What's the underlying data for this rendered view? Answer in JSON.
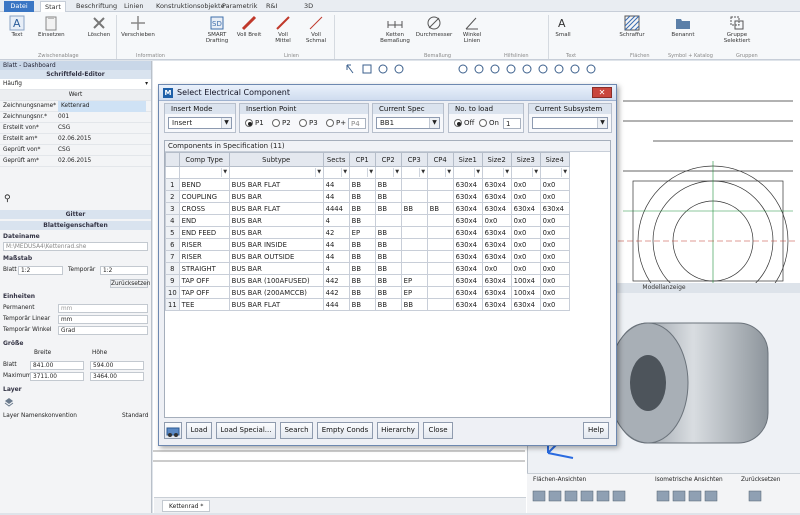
{
  "ribbon": {
    "tabs": [
      "Datei",
      "Start",
      "Beschriftung",
      "Linien",
      "Konstruktionsobjekte",
      "Parametrik",
      "R&I",
      "3D"
    ],
    "tools": [
      "Text",
      "Einsetzen",
      "Löschen",
      "Verschieben",
      "SMART Drafting",
      "Voll Breit",
      "Voll Mittel",
      "Voll Schmal",
      "Ketten Bemaßung",
      "Durchmesser",
      "Winkel Linien",
      "Small",
      "Schraffur",
      "Benannt",
      "Gruppe Selektiert"
    ],
    "groups": [
      "Zwischenablage",
      "Information",
      "Linien",
      "Bemaßung",
      "Hilfslinien",
      "Text",
      "Flächen",
      "Symbol + Katalog",
      "Gruppen"
    ]
  },
  "left_panel": {
    "header": "Blatt - Dashboard",
    "title_editor": "Schriftfeld-Editor",
    "preset": "Häufig",
    "value_header": "Wert",
    "rows": [
      {
        "k": "Zeichnungsname*",
        "v": "Kettenrad"
      },
      {
        "k": "Zeichnungsnr.*",
        "v": "001"
      },
      {
        "k": "Erstellt von*",
        "v": "CSG"
      },
      {
        "k": "Erstellt am*",
        "v": "02.06.2015"
      },
      {
        "k": "Geprüft von*",
        "v": "CSG"
      },
      {
        "k": "Geprüft am*",
        "v": "02.06.2015"
      }
    ],
    "grid_label": "Gitter",
    "sheet_props": "Blatteigenschaften",
    "file_label": "Dateiname",
    "file_value": "M:\\MEDUSA4\\Kettenrad.she",
    "scale_label": "Maßstab",
    "sheet_label": "Blatt",
    "sheet_scale": "1:2",
    "temp_label": "Temporär",
    "temp_scale": "1:2",
    "reset_btn": "Zurücksetzen",
    "units_label": "Einheiten",
    "perm_label": "Permanent",
    "perm_value": "mm",
    "temp_linear_label": "Temporär Linear",
    "temp_linear_value": "mm",
    "temp_angle_label": "Temporär Winkel",
    "temp_angle_value": "Grad",
    "size_label": "Größe",
    "width_label": "Breite",
    "height_label": "Höhe",
    "blatt_label": "Blatt",
    "blatt_w": "841.00",
    "blatt_h": "594.00",
    "max_label": "Maximum",
    "max_w": "3711.00",
    "max_h": "3464.00",
    "layer_label": "Layer",
    "layer_conv_label": "Layer Namenskonvention",
    "layer_conv_value": "Standard"
  },
  "model": {
    "title": "Modellanzeige",
    "bar": [
      "Flächen-Ansichten",
      "Isometrische Ansichten",
      "Zurücksetzen"
    ]
  },
  "doc_tab": "Kettenrad *",
  "dialog": {
    "title": "Select Electrical Component",
    "insert_mode": {
      "label": "Insert Mode",
      "value": "Insert"
    },
    "insertion_point": {
      "label": "Insertion Point",
      "options": [
        "P1",
        "P2",
        "P3",
        "P+"
      ],
      "selected": "P1",
      "custom_placeholder": "P4"
    },
    "current_spec": {
      "label": "Current Spec",
      "value": "BB1"
    },
    "no_to_load": {
      "label": "No. to load",
      "off": "Off",
      "on": "On",
      "selected": "Off",
      "count": "1"
    },
    "current_subsystem": {
      "label": "Current Subsystem",
      "value": ""
    },
    "grid_caption": "Components in Specification (11)",
    "columns": [
      "Comp Type",
      "Subtype",
      "Sects",
      "CP1",
      "CP2",
      "CP3",
      "CP4",
      "Size1",
      "Size2",
      "Size3",
      "Size4"
    ],
    "rows": [
      [
        "1",
        "BEND",
        "BUS BAR FLAT",
        "44",
        "BB",
        "BB",
        "",
        "",
        "630x4",
        "630x4",
        "0x0",
        "0x0"
      ],
      [
        "2",
        "COUPLING",
        "BUS BAR",
        "44",
        "BB",
        "BB",
        "",
        "",
        "630x4",
        "630x4",
        "0x0",
        "0x0"
      ],
      [
        "3",
        "CROSS",
        "BUS BAR FLAT",
        "4444",
        "BB",
        "BB",
        "BB",
        "BB",
        "630x4",
        "630x4",
        "630x4",
        "630x4"
      ],
      [
        "4",
        "END",
        "BUS BAR",
        "4",
        "BB",
        "",
        "",
        "",
        "630x4",
        "0x0",
        "0x0",
        "0x0"
      ],
      [
        "5",
        "END FEED",
        "BUS BAR",
        "42",
        "EP",
        "BB",
        "",
        "",
        "630x4",
        "630x4",
        "0x0",
        "0x0"
      ],
      [
        "6",
        "RISER",
        "BUS BAR INSIDE",
        "44",
        "BB",
        "BB",
        "",
        "",
        "630x4",
        "630x4",
        "0x0",
        "0x0"
      ],
      [
        "7",
        "RISER",
        "BUS BAR OUTSIDE",
        "44",
        "BB",
        "BB",
        "",
        "",
        "630x4",
        "630x4",
        "0x0",
        "0x0"
      ],
      [
        "8",
        "STRAIGHT",
        "BUS BAR",
        "4",
        "BB",
        "BB",
        "",
        "",
        "630x4",
        "0x0",
        "0x0",
        "0x0"
      ],
      [
        "9",
        "TAP OFF",
        "BUS BAR (100AFUSED)",
        "442",
        "BB",
        "BB",
        "EP",
        "",
        "630x4",
        "630x4",
        "100x4",
        "0x0"
      ],
      [
        "10",
        "TAP OFF",
        "BUS BAR (200AMCCB)",
        "442",
        "BB",
        "BB",
        "EP",
        "",
        "630x4",
        "630x4",
        "100x4",
        "0x0"
      ],
      [
        "11",
        "TEE",
        "BUS BAR FLAT",
        "444",
        "BB",
        "BB",
        "BB",
        "",
        "630x4",
        "630x4",
        "630x4",
        "0x0"
      ]
    ],
    "buttons": {
      "load": "Load",
      "load_special": "Load Special...",
      "search": "Search",
      "empty_conds": "Empty Conds",
      "hierarchy": "Hierarchy",
      "close": "Close",
      "help": "Help"
    }
  }
}
